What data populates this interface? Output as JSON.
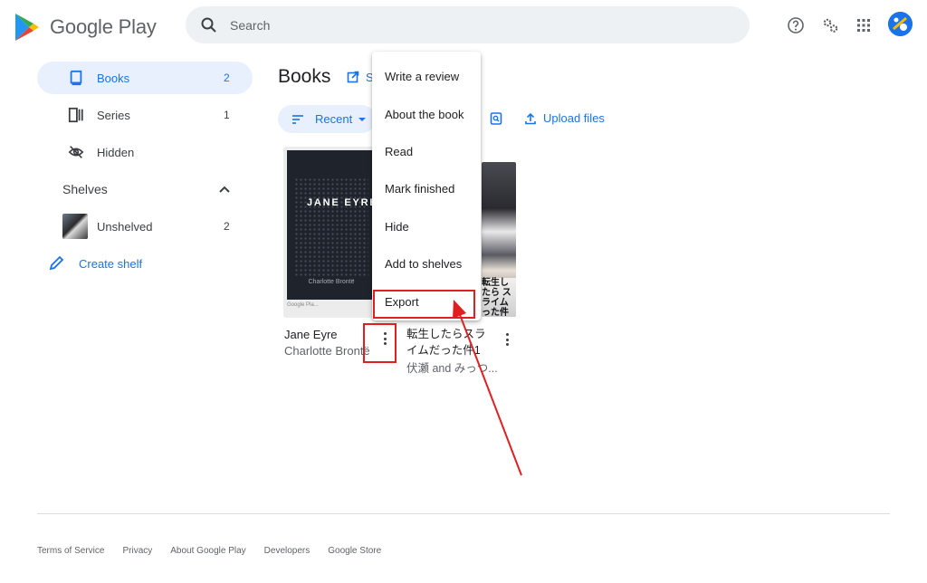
{
  "header": {
    "app_name": "Google Play",
    "search_placeholder": "Search",
    "icons": [
      "help-icon",
      "settings-icon",
      "apps-grid-icon",
      "account-avatar"
    ]
  },
  "sidebar": {
    "items": [
      {
        "label": "Books",
        "count": "2",
        "icon": "book-icon",
        "active": true
      },
      {
        "label": "Series",
        "count": "1",
        "icon": "series-icon"
      },
      {
        "label": "Hidden",
        "count": "",
        "icon": "hidden-eye-icon"
      }
    ],
    "shelves_label": "Shelves",
    "shelves": [
      {
        "label": "Unshelved",
        "count": "2"
      }
    ],
    "create_shelf_label": "Create shelf"
  },
  "main": {
    "title": "Books",
    "title_link_label": "S",
    "sort_label": "Recent",
    "upload_label": "Upload files",
    "books": [
      {
        "title": "Jane Eyre",
        "author": "Charlotte Brontë",
        "cover_title": "JANE EYRE",
        "cover_author": "Charlotte Brontë",
        "cover_footer": "Google Pla..."
      },
      {
        "title": "転生したらスライムだった件1",
        "author": "伏瀬 and みっつ...",
        "cover_text": "転生したら スライム った件"
      }
    ]
  },
  "context_menu": {
    "items": [
      "Write a review",
      "About the book",
      "Read",
      "Mark finished",
      "Hide",
      "Add to shelves",
      "Export"
    ]
  },
  "footer": {
    "links": [
      "Terms of Service",
      "Privacy",
      "About Google Play",
      "Developers",
      "Google Store"
    ]
  },
  "colors": {
    "accent": "#1a73e8",
    "active_bg": "#e8f0fe",
    "annotation_red": "#e02020"
  }
}
